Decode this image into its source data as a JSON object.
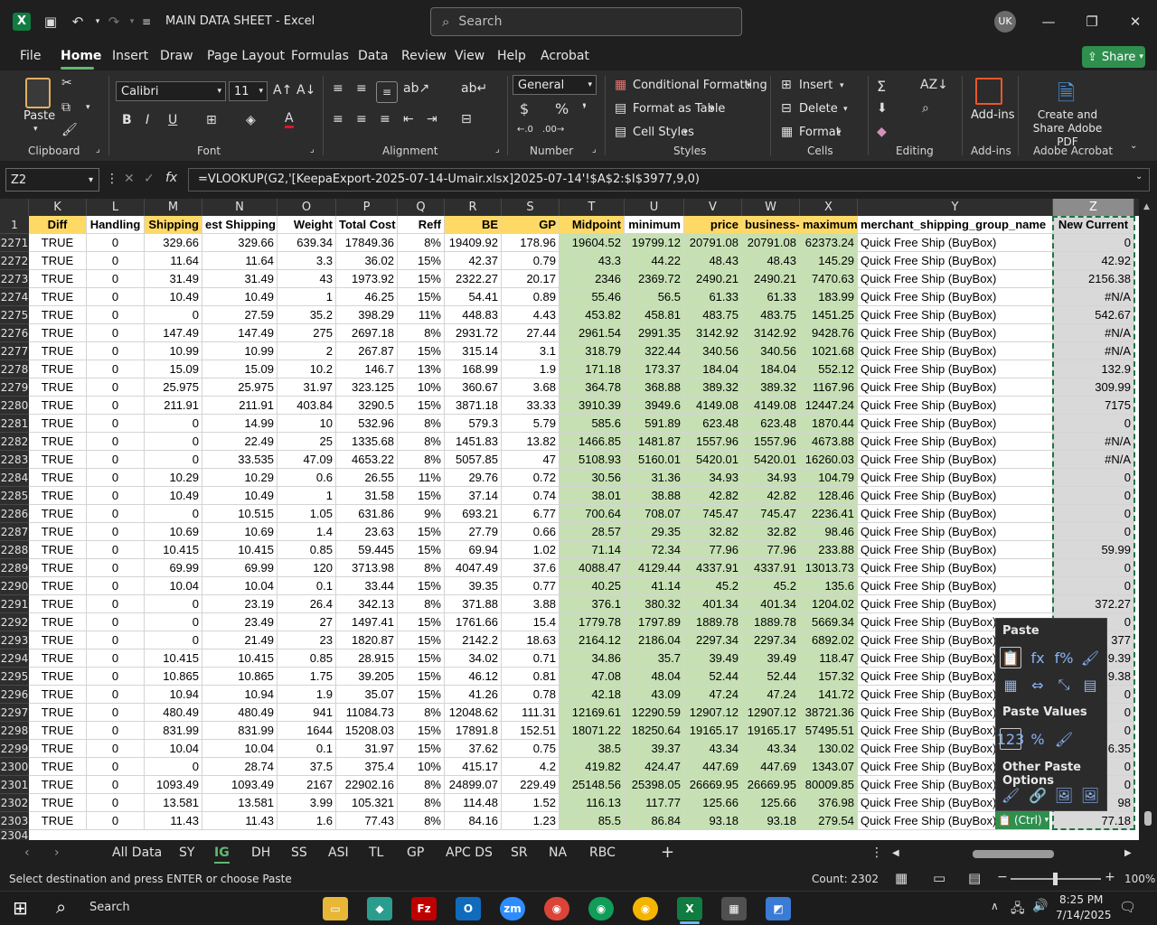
{
  "window": {
    "title": "MAIN DATA SHEET  -  Excel",
    "search_placeholder": "Search",
    "user_initials": "UK"
  },
  "menu": [
    "File",
    "Home",
    "Insert",
    "Draw",
    "Page Layout",
    "Formulas",
    "Data",
    "Review",
    "View",
    "Help",
    "Acrobat"
  ],
  "share_label": "Share",
  "ribbon": {
    "clipboard": {
      "paste": "Paste",
      "label": "Clipboard"
    },
    "font": {
      "name": "Calibri",
      "size": "11",
      "label": "Font"
    },
    "alignment": {
      "label": "Alignment"
    },
    "number": {
      "format": "General",
      "label": "Number"
    },
    "styles": {
      "conditional": "Conditional Formatting",
      "format_table": "Format as Table",
      "cell_styles": "Cell Styles",
      "label": "Styles"
    },
    "cells": {
      "insert": "Insert",
      "delete": "Delete",
      "format": "Format",
      "label": "Cells"
    },
    "editing": {
      "label": "Editing"
    },
    "addins": {
      "button": "Add-ins",
      "label": "Add-ins"
    },
    "acrobat": {
      "button": "Create and Share Adobe PDF",
      "label": "Adobe Acrobat"
    }
  },
  "formula_bar": {
    "name_box": "Z2",
    "formula": "=VLOOKUP(G2,'[KeepaExport-2025-07-14-Umair.xlsx]2025-07-14'!$A$2:$I$3977,9,0)"
  },
  "columns": [
    "K",
    "L",
    "M",
    "N",
    "O",
    "P",
    "Q",
    "R",
    "S",
    "T",
    "U",
    "V",
    "W",
    "X",
    "Y",
    "Z"
  ],
  "headers": [
    "Diff",
    "Handling",
    "Shipping",
    "est Shipping",
    "Weight",
    "Total Cost",
    "Reff",
    "BE",
    "GP",
    "Midpoint",
    "minimum",
    "price",
    "business-",
    "maximum",
    "merchant_shipping_group_name",
    "New Current"
  ],
  "first_row_label": "1",
  "last_row_label": "2304",
  "rows": [
    [
      "2271",
      "TRUE",
      "0",
      "329.66",
      "329.66",
      "639.34",
      "17849.36",
      "8%",
      "19409.92",
      "178.96",
      "19604.52",
      "19799.12",
      "20791.08",
      "20791.08",
      "62373.24",
      "Quick Free Ship (BuyBox)",
      "0"
    ],
    [
      "2272",
      "TRUE",
      "0",
      "11.64",
      "11.64",
      "3.3",
      "36.02",
      "15%",
      "42.37",
      "0.79",
      "43.3",
      "44.22",
      "48.43",
      "48.43",
      "145.29",
      "Quick Free Ship (BuyBox)",
      "42.92"
    ],
    [
      "2273",
      "TRUE",
      "0",
      "31.49",
      "31.49",
      "43",
      "1973.92",
      "15%",
      "2322.27",
      "20.17",
      "2346",
      "2369.72",
      "2490.21",
      "2490.21",
      "7470.63",
      "Quick Free Ship (BuyBox)",
      "2156.38"
    ],
    [
      "2274",
      "TRUE",
      "0",
      "10.49",
      "10.49",
      "1",
      "46.25",
      "15%",
      "54.41",
      "0.89",
      "55.46",
      "56.5",
      "61.33",
      "61.33",
      "183.99",
      "Quick Free Ship (BuyBox)",
      "#N/A"
    ],
    [
      "2275",
      "TRUE",
      "0",
      "0",
      "27.59",
      "35.2",
      "398.29",
      "11%",
      "448.83",
      "4.43",
      "453.82",
      "458.81",
      "483.75",
      "483.75",
      "1451.25",
      "Quick Free Ship (BuyBox)",
      "542.67"
    ],
    [
      "2276",
      "TRUE",
      "0",
      "147.49",
      "147.49",
      "275",
      "2697.18",
      "8%",
      "2931.72",
      "27.44",
      "2961.54",
      "2991.35",
      "3142.92",
      "3142.92",
      "9428.76",
      "Quick Free Ship (BuyBox)",
      "#N/A"
    ],
    [
      "2277",
      "TRUE",
      "0",
      "10.99",
      "10.99",
      "2",
      "267.87",
      "15%",
      "315.14",
      "3.1",
      "318.79",
      "322.44",
      "340.56",
      "340.56",
      "1021.68",
      "Quick Free Ship (BuyBox)",
      "#N/A"
    ],
    [
      "2278",
      "TRUE",
      "0",
      "15.09",
      "15.09",
      "10.2",
      "146.7",
      "13%",
      "168.99",
      "1.9",
      "171.18",
      "173.37",
      "184.04",
      "184.04",
      "552.12",
      "Quick Free Ship (BuyBox)",
      "132.9"
    ],
    [
      "2279",
      "TRUE",
      "0",
      "25.975",
      "25.975",
      "31.97",
      "323.125",
      "10%",
      "360.67",
      "3.68",
      "364.78",
      "368.88",
      "389.32",
      "389.32",
      "1167.96",
      "Quick Free Ship (BuyBox)",
      "309.99"
    ],
    [
      "2280",
      "TRUE",
      "0",
      "211.91",
      "211.91",
      "403.84",
      "3290.5",
      "15%",
      "3871.18",
      "33.33",
      "3910.39",
      "3949.6",
      "4149.08",
      "4149.08",
      "12447.24",
      "Quick Free Ship (BuyBox)",
      "7175"
    ],
    [
      "2281",
      "TRUE",
      "0",
      "0",
      "14.99",
      "10",
      "532.96",
      "8%",
      "579.3",
      "5.79",
      "585.6",
      "591.89",
      "623.48",
      "623.48",
      "1870.44",
      "Quick Free Ship (BuyBox)",
      "0"
    ],
    [
      "2282",
      "TRUE",
      "0",
      "0",
      "22.49",
      "25",
      "1335.68",
      "8%",
      "1451.83",
      "13.82",
      "1466.85",
      "1481.87",
      "1557.96",
      "1557.96",
      "4673.88",
      "Quick Free Ship (BuyBox)",
      "#N/A"
    ],
    [
      "2283",
      "TRUE",
      "0",
      "0",
      "33.535",
      "47.09",
      "4653.22",
      "8%",
      "5057.85",
      "47",
      "5108.93",
      "5160.01",
      "5420.01",
      "5420.01",
      "16260.03",
      "Quick Free Ship (BuyBox)",
      "#N/A"
    ],
    [
      "2284",
      "TRUE",
      "0",
      "10.29",
      "10.29",
      "0.6",
      "26.55",
      "11%",
      "29.76",
      "0.72",
      "30.56",
      "31.36",
      "34.93",
      "34.93",
      "104.79",
      "Quick Free Ship (BuyBox)",
      "0"
    ],
    [
      "2285",
      "TRUE",
      "0",
      "10.49",
      "10.49",
      "1",
      "31.58",
      "15%",
      "37.14",
      "0.74",
      "38.01",
      "38.88",
      "42.82",
      "42.82",
      "128.46",
      "Quick Free Ship (BuyBox)",
      "0"
    ],
    [
      "2286",
      "TRUE",
      "0",
      "0",
      "10.515",
      "1.05",
      "631.86",
      "9%",
      "693.21",
      "6.77",
      "700.64",
      "708.07",
      "745.47",
      "745.47",
      "2236.41",
      "Quick Free Ship (BuyBox)",
      "0"
    ],
    [
      "2287",
      "TRUE",
      "0",
      "10.69",
      "10.69",
      "1.4",
      "23.63",
      "15%",
      "27.79",
      "0.66",
      "28.57",
      "29.35",
      "32.82",
      "32.82",
      "98.46",
      "Quick Free Ship (BuyBox)",
      "0"
    ],
    [
      "2288",
      "TRUE",
      "0",
      "10.415",
      "10.415",
      "0.85",
      "59.445",
      "15%",
      "69.94",
      "1.02",
      "71.14",
      "72.34",
      "77.96",
      "77.96",
      "233.88",
      "Quick Free Ship (BuyBox)",
      "59.99"
    ],
    [
      "2289",
      "TRUE",
      "0",
      "69.99",
      "69.99",
      "120",
      "3713.98",
      "8%",
      "4047.49",
      "37.6",
      "4088.47",
      "4129.44",
      "4337.91",
      "4337.91",
      "13013.73",
      "Quick Free Ship (BuyBox)",
      "0"
    ],
    [
      "2290",
      "TRUE",
      "0",
      "10.04",
      "10.04",
      "0.1",
      "33.44",
      "15%",
      "39.35",
      "0.77",
      "40.25",
      "41.14",
      "45.2",
      "45.2",
      "135.6",
      "Quick Free Ship (BuyBox)",
      "0"
    ],
    [
      "2291",
      "TRUE",
      "0",
      "0",
      "23.19",
      "26.4",
      "342.13",
      "8%",
      "371.88",
      "3.88",
      "376.1",
      "380.32",
      "401.34",
      "401.34",
      "1204.02",
      "Quick Free Ship (BuyBox)",
      "372.27"
    ],
    [
      "2292",
      "TRUE",
      "0",
      "0",
      "23.49",
      "27",
      "1497.41",
      "15%",
      "1761.66",
      "15.4",
      "1779.78",
      "1797.89",
      "1889.78",
      "1889.78",
      "5669.34",
      "Quick Free Ship (BuyBox)",
      "0"
    ],
    [
      "2293",
      "TRUE",
      "0",
      "0",
      "21.49",
      "23",
      "1820.87",
      "15%",
      "2142.2",
      "18.63",
      "2164.12",
      "2186.04",
      "2297.34",
      "2297.34",
      "6892.02",
      "Quick Free Ship (BuyBox)",
      "377"
    ],
    [
      "2294",
      "TRUE",
      "0",
      "10.415",
      "10.415",
      "0.85",
      "28.915",
      "15%",
      "34.02",
      "0.71",
      "34.86",
      "35.7",
      "39.49",
      "39.49",
      "118.47",
      "Quick Free Ship (BuyBox)",
      "9.39"
    ],
    [
      "2295",
      "TRUE",
      "0",
      "10.865",
      "10.865",
      "1.75",
      "39.205",
      "15%",
      "46.12",
      "0.81",
      "47.08",
      "48.04",
      "52.44",
      "52.44",
      "157.32",
      "Quick Free Ship (BuyBox)",
      "9.38"
    ],
    [
      "2296",
      "TRUE",
      "0",
      "10.94",
      "10.94",
      "1.9",
      "35.07",
      "15%",
      "41.26",
      "0.78",
      "42.18",
      "43.09",
      "47.24",
      "47.24",
      "141.72",
      "Quick Free Ship (BuyBox)",
      "0"
    ],
    [
      "2297",
      "TRUE",
      "0",
      "480.49",
      "480.49",
      "941",
      "11084.73",
      "8%",
      "12048.62",
      "111.31",
      "12169.61",
      "12290.59",
      "12907.12",
      "12907.12",
      "38721.36",
      "Quick Free Ship (BuyBox)",
      "0"
    ],
    [
      "2298",
      "TRUE",
      "0",
      "831.99",
      "831.99",
      "1644",
      "15208.03",
      "15%",
      "17891.8",
      "152.51",
      "18071.22",
      "18250.64",
      "19165.17",
      "19165.17",
      "57495.51",
      "Quick Free Ship (BuyBox)",
      "0"
    ],
    [
      "2299",
      "TRUE",
      "0",
      "10.04",
      "10.04",
      "0.1",
      "31.97",
      "15%",
      "37.62",
      "0.75",
      "38.5",
      "39.37",
      "43.34",
      "43.34",
      "130.02",
      "Quick Free Ship (BuyBox)",
      "6.35"
    ],
    [
      "2300",
      "TRUE",
      "0",
      "0",
      "28.74",
      "37.5",
      "375.4",
      "10%",
      "415.17",
      "4.2",
      "419.82",
      "424.47",
      "447.69",
      "447.69",
      "1343.07",
      "Quick Free Ship (BuyBox)",
      "0"
    ],
    [
      "2301",
      "TRUE",
      "0",
      "1093.49",
      "1093.49",
      "2167",
      "22902.16",
      "8%",
      "24899.07",
      "229.49",
      "25148.56",
      "25398.05",
      "26669.95",
      "26669.95",
      "80009.85",
      "Quick Free Ship (BuyBox)",
      "0"
    ],
    [
      "2302",
      "TRUE",
      "0",
      "13.581",
      "13.581",
      "3.99",
      "105.321",
      "8%",
      "114.48",
      "1.52",
      "116.13",
      "117.77",
      "125.66",
      "125.66",
      "376.98",
      "Quick Free Ship (BuyBox)",
      "98"
    ],
    [
      "2303",
      "TRUE",
      "0",
      "11.43",
      "11.43",
      "1.6",
      "77.43",
      "8%",
      "84.16",
      "1.23",
      "85.5",
      "86.84",
      "93.18",
      "93.18",
      "279.54",
      "Quick Free Ship (BuyBox)",
      "77.18"
    ]
  ],
  "paste_menu": {
    "title": "Paste",
    "values_title": "Paste Values",
    "other_title": "Other Paste Options",
    "ctrl_label": "(Ctrl)"
  },
  "sheet_tabs": [
    "All Data",
    "SY",
    "IG",
    "DH",
    "SS",
    "ASI",
    "TL",
    "GP",
    "APC DS",
    "SR",
    "NA",
    "RBC"
  ],
  "active_tab": "IG",
  "status": {
    "message": "Select destination and press ENTER or choose Paste",
    "count": "Count: 2302",
    "zoom": "100%"
  },
  "taskbar": {
    "search": "Search",
    "time": "8:25 PM",
    "date": "7/14/2025"
  }
}
